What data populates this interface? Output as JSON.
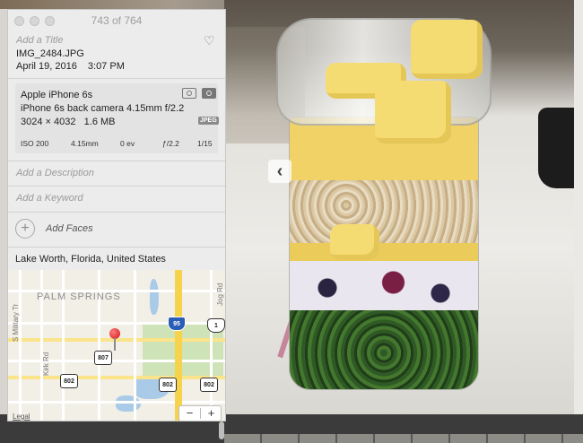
{
  "window": {
    "counter": "743 of 764"
  },
  "info": {
    "title_placeholder": "Add a Title",
    "favorite_icon": "heart-icon",
    "filename": "IMG_2484.JPG",
    "date": "April 19, 2016",
    "time": "3:07 PM"
  },
  "camera": {
    "model": "Apple iPhone 6s",
    "lens": "iPhone 6s back camera 4.15mm f/2.2",
    "dimensions": "3024 × 4032",
    "size": "1.6 MB",
    "format_badge": "JPEG",
    "icons": [
      "camera-icon",
      "photo-mode-icon"
    ],
    "exif": {
      "iso": "ISO 200",
      "focal_length": "4.15mm",
      "exposure_bias": "0 ev",
      "aperture": "ƒ/2.2",
      "shutter": "1/15"
    }
  },
  "fields": {
    "description_placeholder": "Add a Description",
    "keyword_placeholder": "Add a Keyword",
    "add_faces_label": "Add Faces"
  },
  "location": "Lake Worth, Florida, United States",
  "map": {
    "area_label": "PALM SPRINGS",
    "streets": [
      "S Military Tr",
      "Kirk Rd",
      "Jog Rd"
    ],
    "shields": [
      "95",
      "1",
      "807",
      "802",
      "802",
      "802"
    ],
    "zoom_out": "−",
    "zoom_in": "+",
    "legal": "Legal"
  },
  "viewer": {
    "back_button": "‹"
  }
}
